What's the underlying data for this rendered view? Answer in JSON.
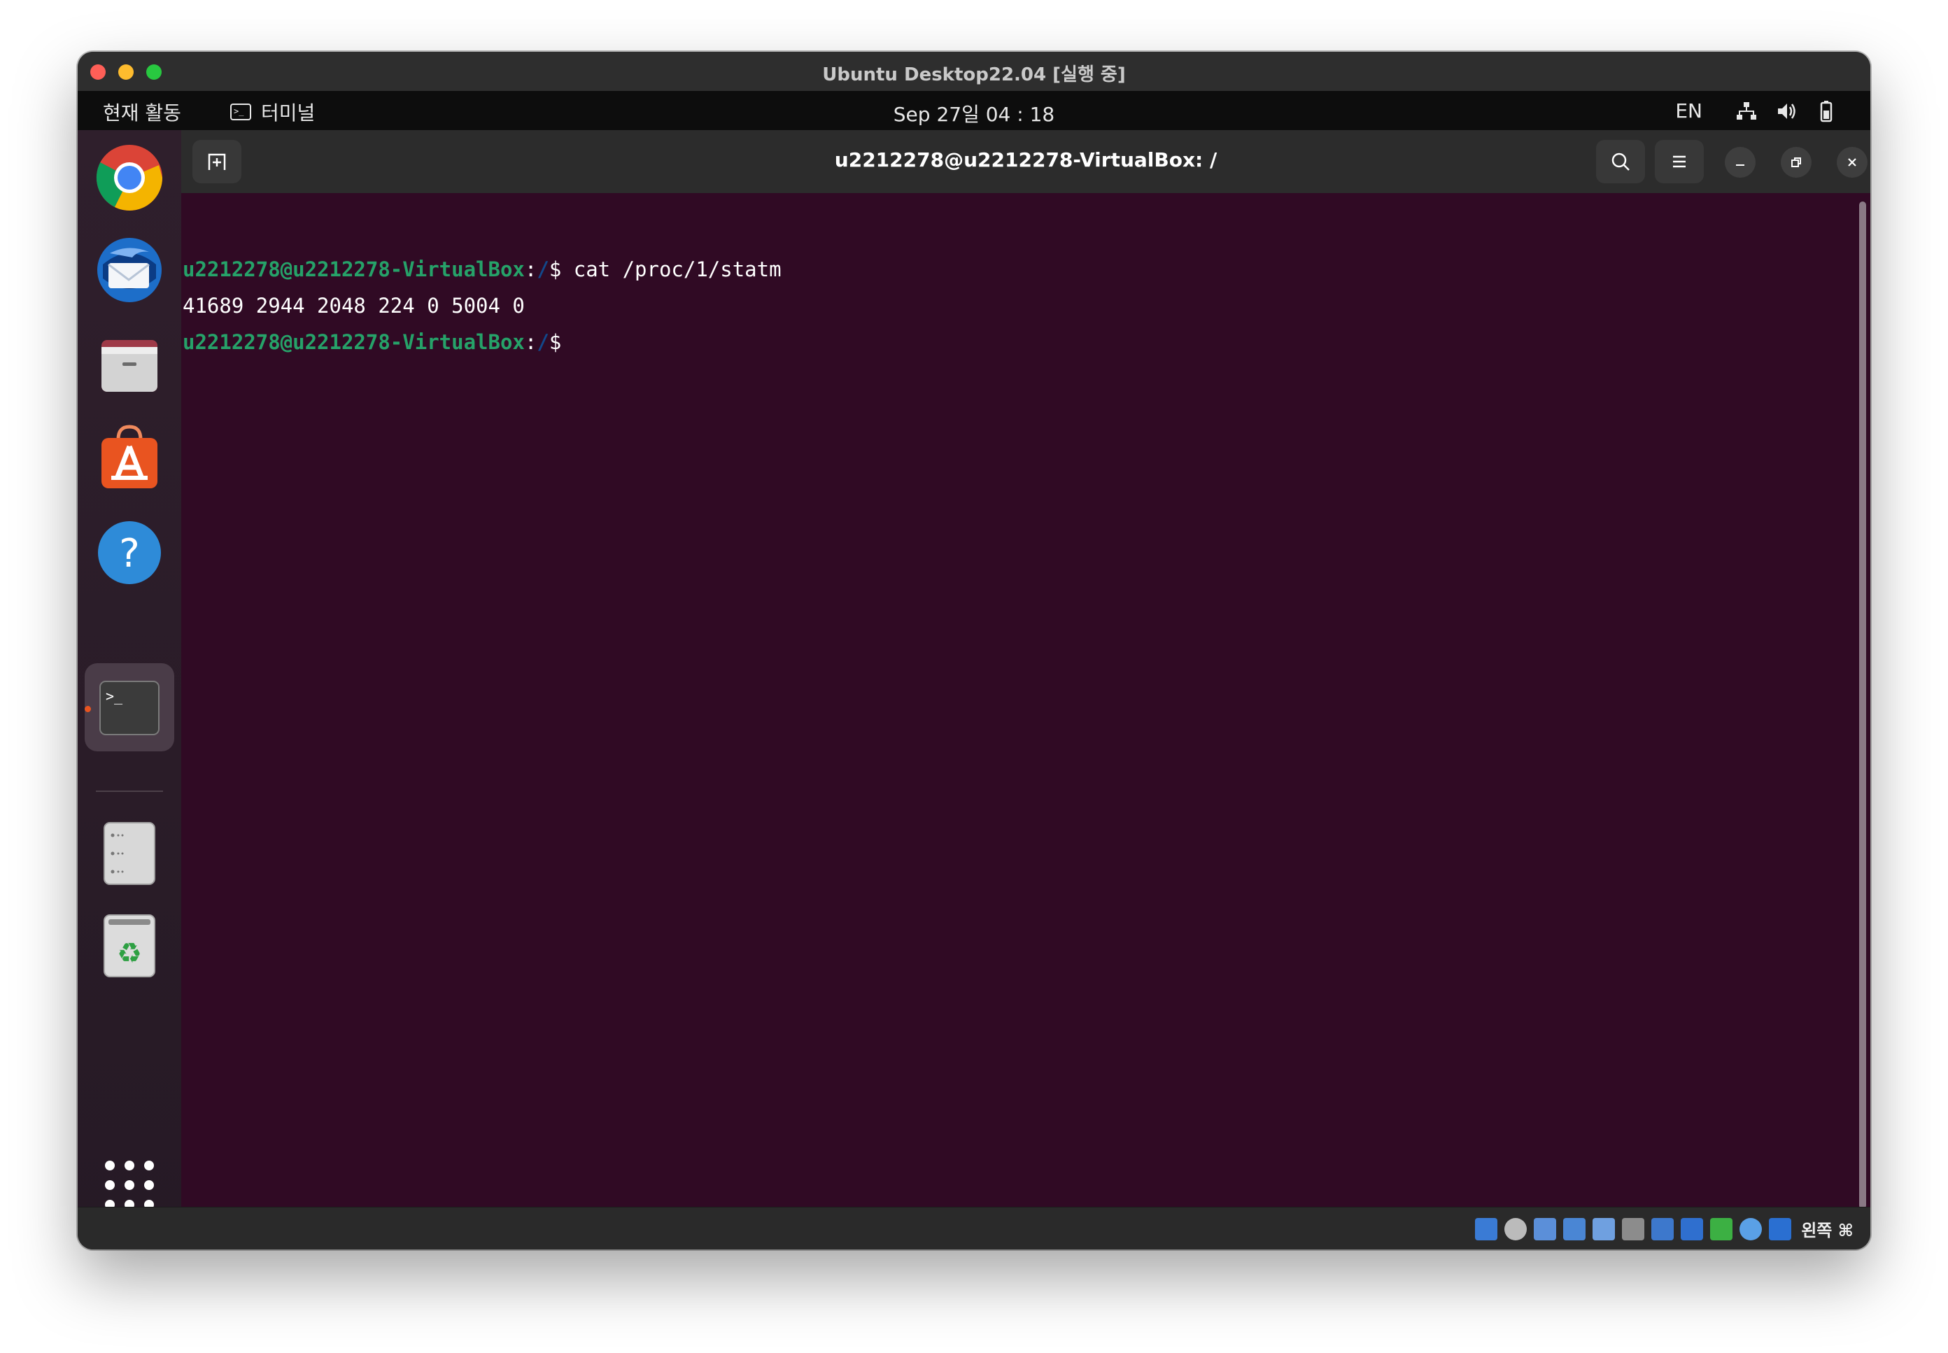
{
  "mac_window": {
    "title": "Ubuntu Desktop22.04 [실행 중]"
  },
  "topbar": {
    "activities": "현재 활동",
    "app_name": "터미널",
    "clock": "Sep 27일  04 : 18",
    "language": "EN"
  },
  "dock": {
    "items": [
      "chrome-icon",
      "thunderbird-icon",
      "files-icon",
      "app-center-icon",
      "help-icon",
      "terminal-icon",
      "disk-icon",
      "trash-icon",
      "show-apps-icon"
    ]
  },
  "terminal_window": {
    "title": "u2212278@u2212278-VirtualBox: /",
    "lines": [
      {
        "user": "u2212278@u2212278-VirtualBox",
        "sep": ":",
        "path": "/",
        "dollar": "$ ",
        "command": "cat /proc/1/statm"
      },
      {
        "output": "41689 2944 2048 224 0 5004 0"
      },
      {
        "user": "u2212278@u2212278-VirtualBox",
        "sep": ":",
        "path": "/",
        "dollar": "$",
        "command": ""
      }
    ]
  },
  "statusbar": {
    "host_key": "왼쪽 ⌘"
  },
  "colors": {
    "terminal_bg": "#300a24",
    "prompt_user": "#26a269",
    "prompt_path": "#12488b",
    "ubuntu_orange": "#e95420"
  }
}
